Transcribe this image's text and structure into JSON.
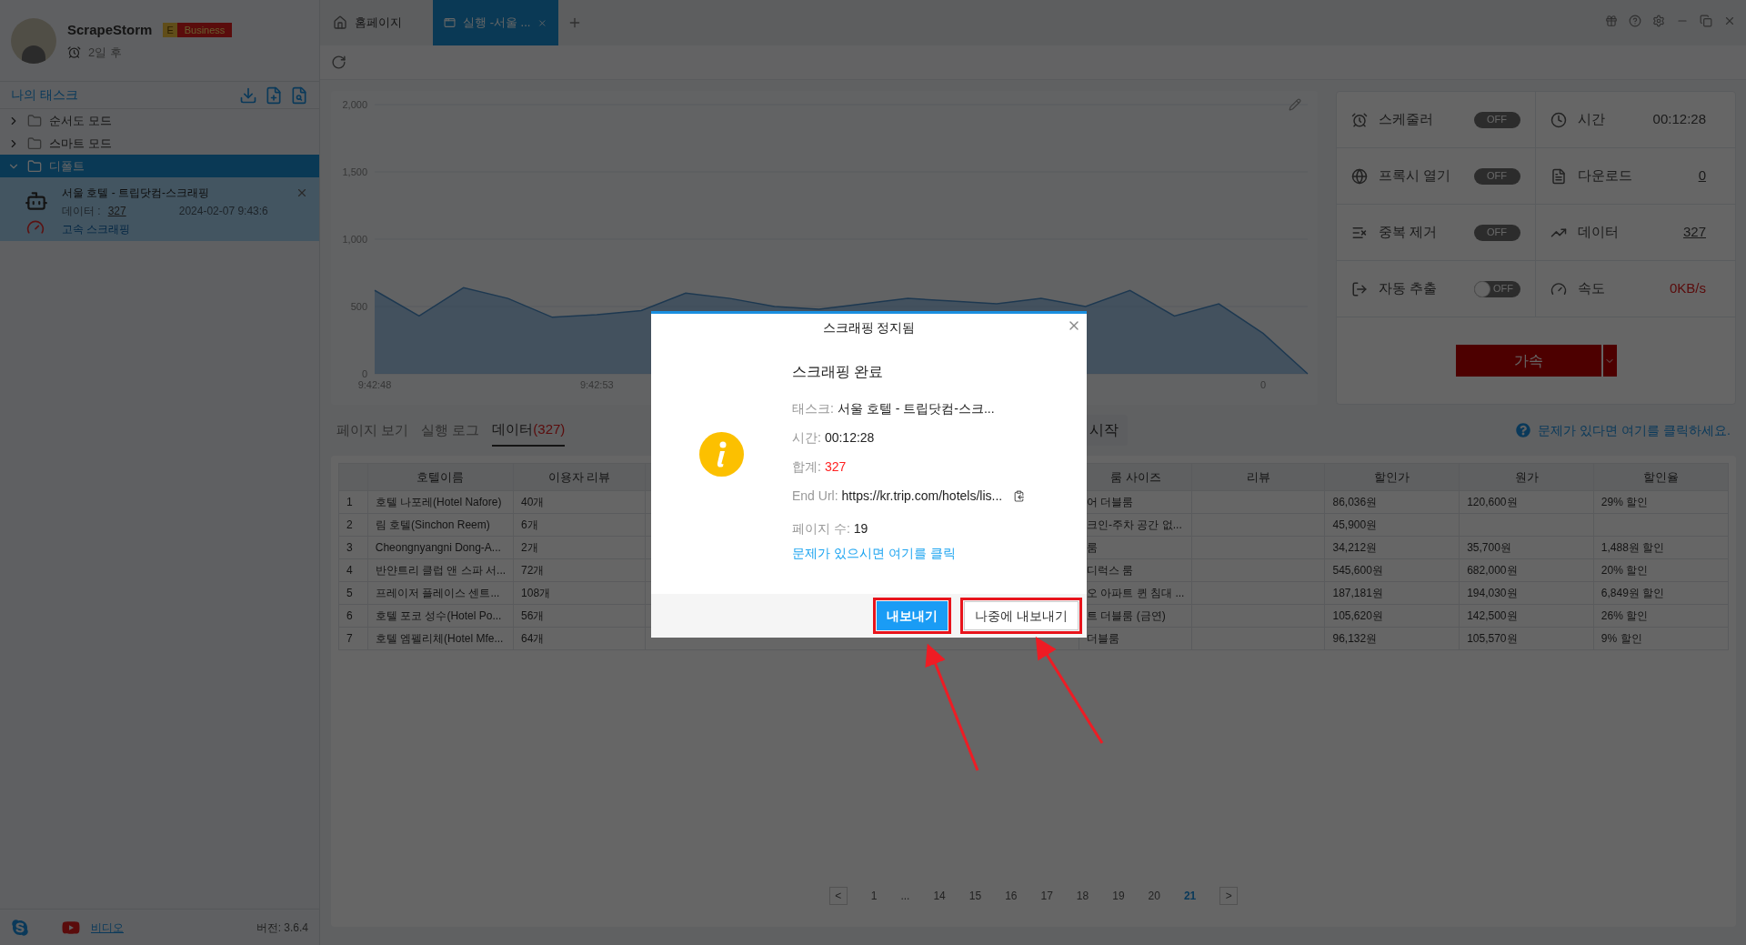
{
  "app": {
    "name": "ScrapeStorm",
    "edition_letter": "E",
    "edition": "Business",
    "expiry": "2일 후"
  },
  "sidebar": {
    "title": "나의 태스크",
    "folders": [
      {
        "label": "순서도 모드",
        "expanded": false,
        "selected": false
      },
      {
        "label": "스마트 모드",
        "expanded": false,
        "selected": false
      },
      {
        "label": "디폴트",
        "expanded": true,
        "selected": true,
        "children": [
          {
            "title": "서울 호텔 - 트립닷컴-스크래핑",
            "data_label": "데이터 :",
            "data_count": "327",
            "date": "2024-02-07 9:43:6",
            "mode": "고속 스크래핑"
          }
        ]
      }
    ]
  },
  "footer": {
    "video": "비디오",
    "version": "버전: 3.6.4"
  },
  "tabs": [
    {
      "kind": "home",
      "label": "홈페이지",
      "selected": false
    },
    {
      "kind": "run",
      "label": "실행 -서울 ...",
      "selected": true
    }
  ],
  "chart": {
    "chart_data": {
      "type": "area",
      "categories": [
        "9:42:48",
        null,
        null,
        null,
        null,
        "9:42:53",
        null,
        null,
        null,
        null,
        null,
        null,
        null,
        null,
        null,
        null,
        null,
        null,
        null,
        null,
        "0",
        null
      ],
      "series": [
        {
          "color": "#6aa6dc",
          "values": [
            620,
            430,
            640,
            560,
            420,
            440,
            470,
            600,
            560,
            500,
            480,
            520,
            560,
            540,
            520,
            560,
            500,
            620,
            430,
            520,
            300,
            0
          ]
        }
      ],
      "ylim": [
        0,
        2000
      ],
      "yticks": [
        {
          "value": 0,
          "label": "0"
        },
        {
          "value": 500,
          "label": "500"
        },
        {
          "value": 1000,
          "label": "1,000"
        },
        {
          "value": 1500,
          "label": "1,500"
        },
        {
          "value": 2000,
          "label": "2,000"
        }
      ]
    }
  },
  "stats": [
    {
      "kind": "toggle",
      "label": "스케줄러",
      "state_text": "OFF",
      "on": false
    },
    {
      "kind": "value",
      "label": "시간",
      "value": "00:12:28",
      "underlined": false,
      "alert": false
    },
    {
      "kind": "toggle",
      "label": "프록시 열기",
      "state_text": "OFF",
      "on": false
    },
    {
      "kind": "value",
      "label": "다운로드",
      "value": "0",
      "underlined": true,
      "alert": false
    },
    {
      "kind": "toggle",
      "label": "중복 제거",
      "state_text": "OFF",
      "on": false
    },
    {
      "kind": "value",
      "label": "데이터",
      "value": "327",
      "underlined": true,
      "alert": false
    },
    {
      "kind": "switch",
      "label": "자동 추출",
      "state_text": "OFF",
      "on": false
    },
    {
      "kind": "value",
      "label": "속도",
      "value": "0KB/s",
      "underlined": false,
      "alert": true
    }
  ],
  "accelerate_button": "가속",
  "view_tabs": [
    {
      "label": "페이지 보기",
      "selected": false
    },
    {
      "label": "실행 로그",
      "selected": false
    },
    {
      "label": "데이터",
      "count": "(327)",
      "selected": true
    }
  ],
  "start_button": "시작",
  "help_link": "문제가 있다면 여기를 클릭하세요.",
  "table": {
    "columns": [
      "호텔이름",
      "이용자 리뷰",
      "룸 사이즈",
      "리뷰",
      "할인가",
      "원가",
      "할인율"
    ],
    "rows": [
      {
        "no": "1",
        "hotel_name": "호텔 나포레(Hotel Nafore)",
        "user_reviews": "40개",
        "room_size": "어 더블룸",
        "sale_price": "86,036원",
        "original_price": "120,600원",
        "discount": "29% 할인"
      },
      {
        "no": "2",
        "hotel_name": "림 호텔(Sinchon Reem)",
        "user_reviews": "6개",
        "room_size": "크인-주차 공간 없...",
        "sale_price": "45,900원"
      },
      {
        "no": "3",
        "hotel_name": "Cheongnyangni Dong-A...",
        "user_reviews": "2개",
        "room_size": "룸",
        "sale_price": "34,212원",
        "original_price": "35,700원",
        "discount": "1,488원 할인"
      },
      {
        "no": "4",
        "hotel_name": "반얀트리 클럽 앤 스파 서...",
        "user_reviews": "72개",
        "room_size": "디럭스 룸",
        "sale_price": "545,600원",
        "original_price": "682,000원",
        "discount": "20% 할인"
      },
      {
        "no": "5",
        "hotel_name": "프레이저 플레이스 센트...",
        "user_reviews": "108개",
        "room_size": "오 아파트 퀸 침대 ...",
        "sale_price": "187,181원",
        "original_price": "194,030원",
        "discount": "6,849원 할인"
      },
      {
        "no": "6",
        "hotel_name": "호텔 포코 성수(Hotel Po...",
        "user_reviews": "56개",
        "room_size": "트 더블룸 (금연)",
        "sale_price": "105,620원",
        "original_price": "142,500원",
        "discount": "26% 할인"
      },
      {
        "no": "7",
        "hotel_name": "호텔 엠펠리체(Hotel Mfe...",
        "user_reviews": "64개",
        "room_size": "더블룸",
        "sale_price": "96,132원",
        "original_price": "105,570원",
        "discount": "9% 할인"
      }
    ]
  },
  "pagination": {
    "prev": "<",
    "next": ">",
    "pages": [
      {
        "label": "1",
        "selected": false
      },
      {
        "label": "...",
        "selected": false
      },
      {
        "label": "14",
        "selected": false
      },
      {
        "label": "15",
        "selected": false
      },
      {
        "label": "16",
        "selected": false
      },
      {
        "label": "17",
        "selected": false
      },
      {
        "label": "18",
        "selected": false
      },
      {
        "label": "19",
        "selected": false
      },
      {
        "label": "20",
        "selected": false
      },
      {
        "label": "21",
        "selected": true
      }
    ]
  },
  "dialog": {
    "title": "스크래핑 정지됨",
    "heading": "스크래핑 완료",
    "fields": [
      {
        "kind": "text",
        "label": "태스크:",
        "value": "서울 호텔 - 트립닷컴-스크..."
      },
      {
        "kind": "text",
        "label": "시간:",
        "value": "00:12:28"
      },
      {
        "kind": "alert",
        "label": "합계:",
        "value": "327"
      },
      {
        "kind": "url",
        "label": "End Url:",
        "value": "https://kr.trip.com/hotels/lis..."
      },
      {
        "kind": "text",
        "label": "페이지 수:",
        "value": "19"
      }
    ],
    "help_link": "문제가 있으시면 여기를 클릭",
    "primary_button": "내보내기",
    "secondary_button": "나중에 내보내기"
  }
}
